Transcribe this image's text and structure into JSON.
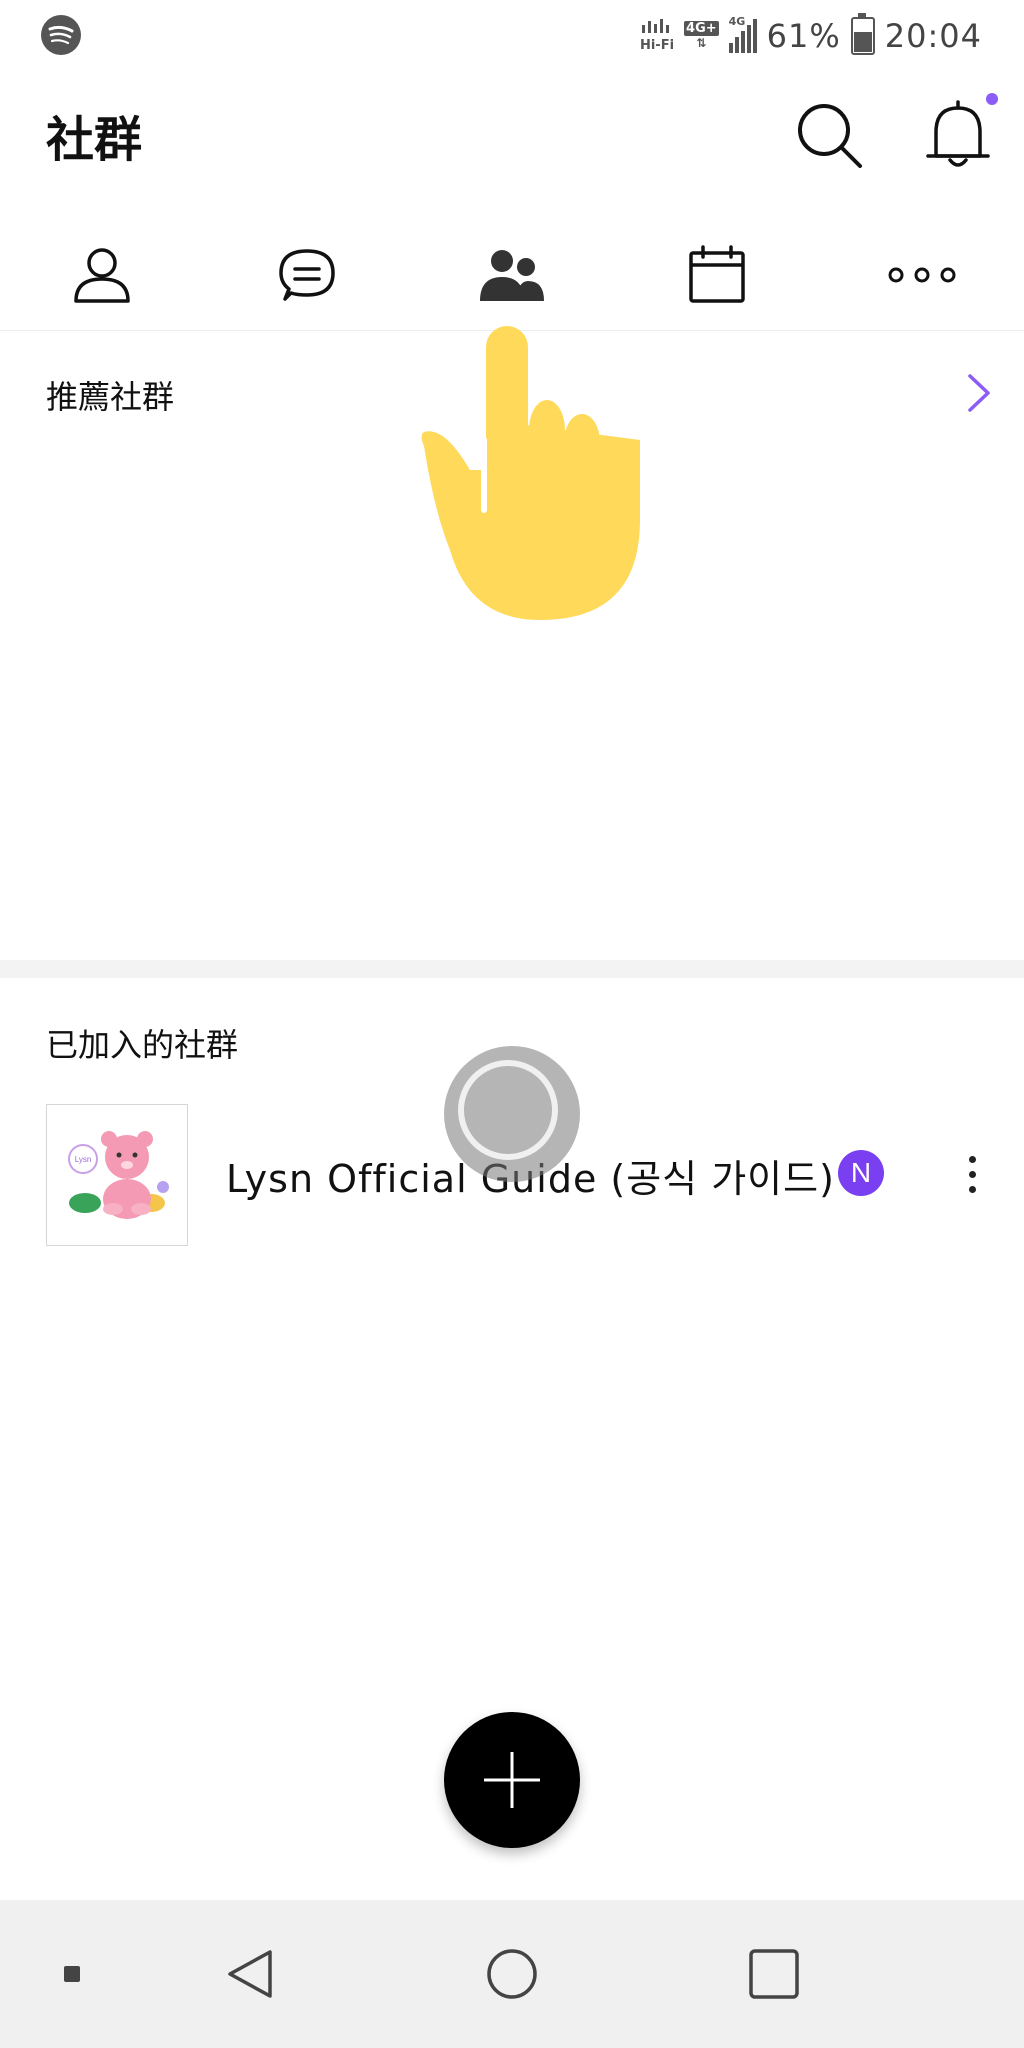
{
  "status_bar": {
    "hifi_label": "Hi-Fi",
    "network_4g_plus": "4G+",
    "network_4g": "4G",
    "battery_percent": "61%",
    "time": "20:04",
    "battery_level": 0.61
  },
  "header": {
    "title": "社群"
  },
  "nav": {
    "items": [
      {
        "icon": "person-icon",
        "selected": false
      },
      {
        "icon": "chat-icon",
        "selected": false
      },
      {
        "icon": "community-icon",
        "selected": true
      },
      {
        "icon": "calendar-icon",
        "selected": false
      },
      {
        "icon": "more-horizontal-icon",
        "selected": false
      }
    ]
  },
  "recommended": {
    "title": "推薦社群"
  },
  "joined": {
    "title": "已加入的社群",
    "communities": [
      {
        "name": "Lysn Official Guide (공식 가이드)",
        "badge": "N",
        "thumb_text": "Lysn"
      }
    ]
  },
  "colors": {
    "accent": "#8b5cf6",
    "badge": "#7a3ff0",
    "fab": "#000000",
    "hand": "#ffd95a"
  }
}
